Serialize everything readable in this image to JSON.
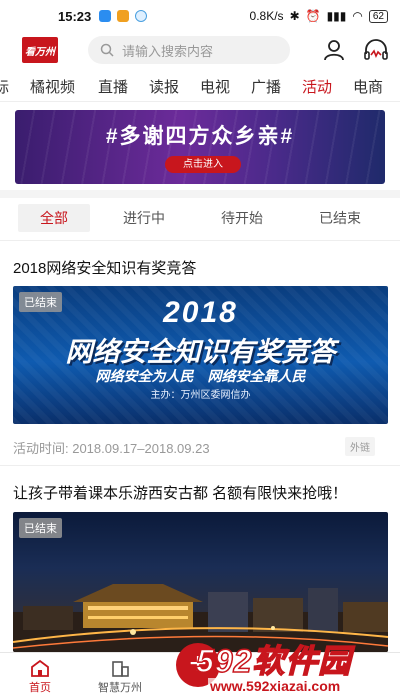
{
  "status_bar": {
    "time": "15:23",
    "network_speed": "0.8K/s",
    "battery": "62"
  },
  "header": {
    "logo_text": "看万州",
    "search_placeholder": "请输入搜索内容"
  },
  "tabs": [
    {
      "label": "际"
    },
    {
      "label": "橘视频"
    },
    {
      "label": "直播"
    },
    {
      "label": "读报"
    },
    {
      "label": "电视"
    },
    {
      "label": "广播"
    },
    {
      "label": "活动",
      "active": true
    },
    {
      "label": "电商"
    }
  ],
  "banner": {
    "title": "#多谢四方众乡亲#",
    "button": "点击进入"
  },
  "filters": [
    {
      "label": "全部",
      "active": true
    },
    {
      "label": "进行中"
    },
    {
      "label": "待开始"
    },
    {
      "label": "已结束"
    }
  ],
  "activities": [
    {
      "title": "2018网络安全知识有奖竞答",
      "badge": "已结束",
      "image_year": "2018",
      "image_main": "网络安全知识有奖竞答",
      "image_sub": "网络安全为人民　网络安全靠人民",
      "image_org": "主办：万州区委网信办",
      "time_text": "活动时间: 2018.09.17–2018.09.23",
      "tag": "外链"
    },
    {
      "title": "让孩子带着课本乐游西安古都 名额有限快来抢哦！",
      "badge": "已结束"
    }
  ],
  "bottom_nav": {
    "home": "首页",
    "smart": "智慧万州",
    "center": "+"
  },
  "watermark": {
    "big": "592软件园",
    "url": "www.592xiazai.com"
  },
  "colors": {
    "accent": "#c8161d"
  }
}
